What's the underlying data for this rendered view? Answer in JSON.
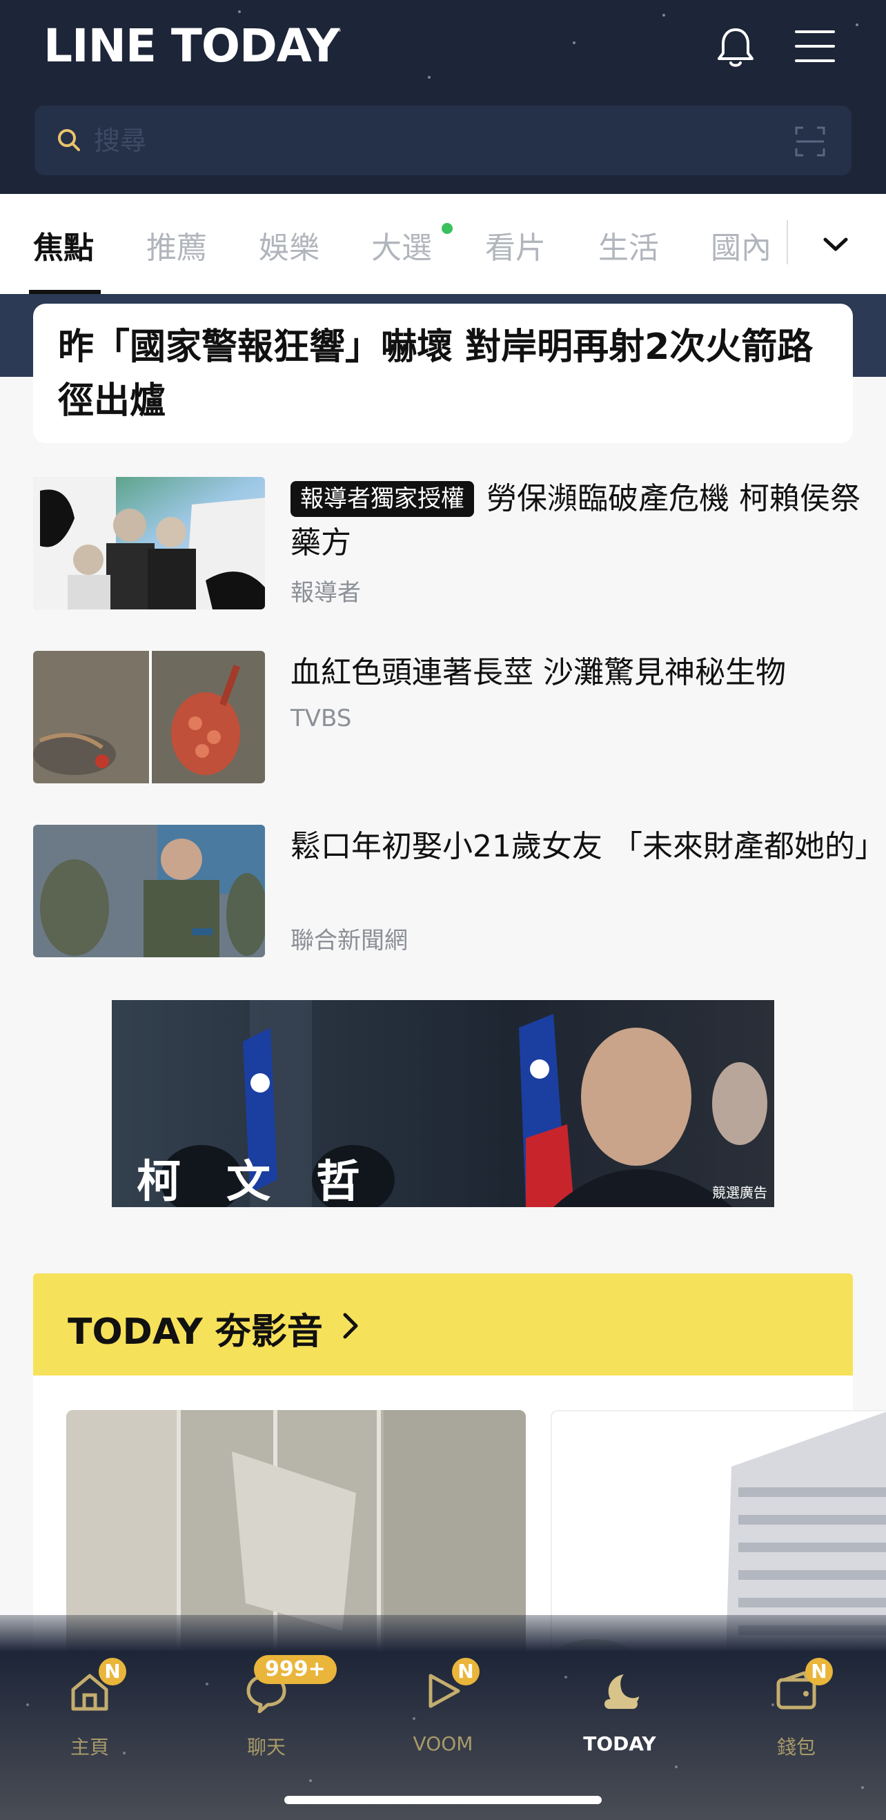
{
  "header": {
    "logo": "LINE TODAY",
    "search_placeholder": "搜尋"
  },
  "tabs": [
    {
      "label": "焦點",
      "active": true
    },
    {
      "label": "推薦"
    },
    {
      "label": "娛樂"
    },
    {
      "label": "大選",
      "has_dot": true
    },
    {
      "label": "看片"
    },
    {
      "label": "生活"
    },
    {
      "label": "國內"
    }
  ],
  "headline": "昨「國家警報狂響」嚇壞 對岸明再射2次火箭路徑出爐",
  "news": [
    {
      "badge": "報導者獨家授權",
      "title": "勞保瀕臨破產危機 柯賴侯祭藥方",
      "source": "報導者"
    },
    {
      "title": "血紅色頭連著長莖 沙灘驚見神秘生物",
      "source": "TVBS"
    },
    {
      "title": "鬆口年初娶小21歲女友 「未來財產都她的」",
      "source": "聯合新聞網"
    }
  ],
  "ad": {
    "text": "柯文哲",
    "tag": "競選廣告"
  },
  "video_section": {
    "title": "TODAY 夯影音"
  },
  "tabbar": {
    "items": [
      {
        "label": "主頁",
        "badge": "N"
      },
      {
        "label": "聊天",
        "badge": "999+"
      },
      {
        "label": "VOOM",
        "badge": "N"
      },
      {
        "label": "TODAY",
        "active": true
      },
      {
        "label": "錢包",
        "badge": "N"
      }
    ]
  },
  "colors": {
    "header_bg": "#1d2538",
    "accent_yellow": "#f6e15a",
    "badge_gold": "#e9b53a",
    "dot_green": "#3ac15b"
  }
}
